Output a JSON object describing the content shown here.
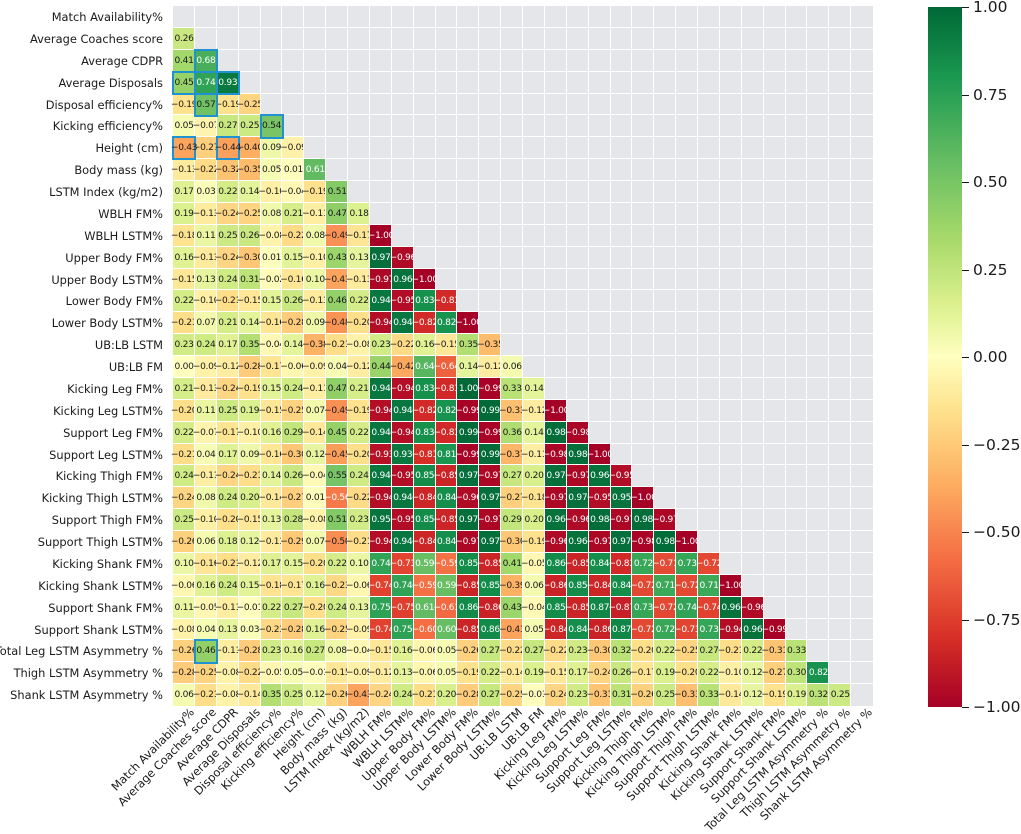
{
  "chart_data": {
    "type": "heatmap",
    "title": "",
    "xlabel": "",
    "ylabel": "",
    "mask": "lower-triangle (strictly below diagonal shown; diagonal and upper triangle blank)",
    "grid": true,
    "colorbar": {
      "colormap": "RdYlGn",
      "position": "right",
      "vmin": -1.0,
      "vmax": 1.0,
      "ticks": [
        "1.00",
        "0.75",
        "0.50",
        "0.25",
        "0.00",
        "-0.25",
        "-0.50",
        "-0.75",
        "-1.00"
      ],
      "tick_values": [
        1.0,
        0.75,
        0.5,
        0.25,
        0.0,
        -0.25,
        -0.5,
        -0.75,
        -1.0
      ]
    },
    "categories": [
      "Match Availability%",
      "Average Coaches score",
      "Average CDPR",
      "Average Disposals",
      "Disposal efficiency%",
      "Kicking efficiency%",
      "Height (cm)",
      "Body mass (kg)",
      "LSTM Index (kg/m2)",
      "WBLH FM%",
      "WBLH LSTM%",
      "Upper Body FM%",
      "Upper Body LSTM%",
      "Lower Body FM%",
      "Lower Body LSTM%",
      "UB:LB LSTM",
      "UB:LB FM",
      "Kicking Leg FM%",
      "Kicking Leg LSTM%",
      "Support Leg FM%",
      "Support Leg LSTM%",
      "Kicking Thigh FM%",
      "Kicking Thigh LSTM%",
      "Support Thigh FM%",
      "Support Thigh LSTM%",
      "Kicking Shank FM%",
      "Kicking Shank LSTM%",
      "Support Shank FM%",
      "Support Shank LSTM%",
      "Total Leg LSTM Asymmetry %",
      "Thigh LSTM Asymmetry %",
      "Shank LSTM Asymmetry %"
    ],
    "xtick_labels": [
      "Match Availability%",
      "Average Coaches score",
      "Average CDPR",
      "Average Disposals",
      "Disposal efficiency%",
      "Kicking efficiency%",
      "Height (cm)",
      "Body mass (kg)",
      "LSTM Index (kg/m2)",
      "WBLH FM%",
      "WBLH LSTM%",
      "Upper Body FM%",
      "Upper Body LSTM%",
      "Lower Body FM%",
      "Lower Body LSTM%",
      "UB:LB LSTM",
      "UB:LB FM",
      "Kicking Leg FM%",
      "Kicking Leg LSTM%",
      "Support Leg FM%",
      "Support Leg LSTM%",
      "Kicking Thigh FM%",
      "Kicking Thigh LSTM%",
      "Support Thigh FM%",
      "Support Thigh LSTM%",
      "Kicking Shank FM%",
      "Kicking Shank LSTM%",
      "Support Shank FM%",
      "Support Shank LSTM%",
      "Total Leg LSTM Asymmetry %",
      "Thigh LSTM Asymmetry %",
      "Shank LSTM Asymmetry %"
    ],
    "rows": [
      {
        "label": "Match Availability%",
        "values": []
      },
      {
        "label": "Average Coaches score",
        "values": [
          0.26
        ]
      },
      {
        "label": "Average CDPR",
        "values": [
          0.41,
          0.68
        ]
      },
      {
        "label": "Average Disposals",
        "values": [
          0.45,
          0.74,
          0.93
        ]
      },
      {
        "label": "Disposal efficiency%",
        "values": [
          -0.19,
          0.57,
          -0.19,
          -0.25
        ]
      },
      {
        "label": "Kicking efficiency%",
        "values": [
          0.05,
          -0.07,
          0.27,
          0.25,
          0.54
        ]
      },
      {
        "label": "Height (cm)",
        "values": [
          -0.43,
          -0.27,
          -0.44,
          -0.4,
          0.09,
          -0.09
        ]
      },
      {
        "label": "Body mass (kg)",
        "values": [
          -0.13,
          -0.22,
          -0.32,
          -0.35,
          0.05,
          0.01,
          0.61
        ]
      },
      {
        "label": "LSTM Index (kg/m2)",
        "values": [
          0.17,
          0.03,
          0.22,
          0.14,
          -0.1,
          -0.04,
          -0.19,
          0.51
        ]
      },
      {
        "label": "WBLH FM%",
        "values": [
          0.19,
          -0.13,
          -0.24,
          -0.25,
          0.08,
          0.21,
          -0.11,
          0.47,
          0.18
        ]
      },
      {
        "label": "WBLH LSTM%",
        "values": [
          -0.18,
          0.11,
          0.25,
          0.26,
          -0.08,
          -0.22,
          0.08,
          -0.49,
          -0.17,
          -1.0
        ]
      },
      {
        "label": "Upper Body FM%",
        "values": [
          0.16,
          -0.13,
          -0.24,
          -0.3,
          0.01,
          0.15,
          -0.1,
          0.43,
          0.13,
          0.97,
          -0.96
        ]
      },
      {
        "label": "Upper Body LSTM%",
        "values": [
          -0.15,
          0.13,
          0.24,
          0.31,
          -0.02,
          -0.16,
          0.1,
          -0.43,
          -0.13,
          -0.97,
          0.96,
          -1.0
        ]
      },
      {
        "label": "Lower Body FM%",
        "values": [
          0.22,
          -0.1,
          -0.21,
          -0.15,
          0.15,
          0.26,
          -0.13,
          0.46,
          0.22,
          0.94,
          -0.95,
          0.83,
          -0.83
        ]
      },
      {
        "label": "Lower Body LSTM%",
        "values": [
          -0.21,
          0.07,
          0.21,
          0.14,
          -0.16,
          -0.28,
          0.09,
          -0.48,
          -0.2,
          -0.94,
          0.94,
          -0.82,
          0.82,
          -1.0
        ]
      },
      {
        "label": "UB:LB LSTM",
        "values": [
          0.23,
          0.24,
          0.17,
          0.35,
          -0.04,
          0.14,
          -0.38,
          -0.21,
          -0.08,
          0.23,
          -0.22,
          0.16,
          -0.15,
          0.35,
          -0.35
        ]
      },
      {
        "label": "UB:LB FM",
        "values": [
          0.0,
          -0.09,
          -0.12,
          -0.28,
          -0.17,
          -0.06,
          -0.09,
          0.04,
          -0.12,
          0.44,
          -0.42,
          0.64,
          -0.64,
          0.14,
          -0.12,
          0.06
        ]
      },
      {
        "label": "Kicking Leg FM%",
        "values": [
          0.21,
          -0.13,
          -0.24,
          -0.19,
          0.15,
          0.24,
          -0.11,
          0.47,
          0.21,
          0.94,
          -0.94,
          0.83,
          -0.83,
          1.0,
          -0.99,
          0.33,
          0.14
        ]
      },
      {
        "label": "Kicking Leg LSTM%",
        "values": [
          -0.2,
          0.11,
          0.25,
          0.19,
          -0.15,
          -0.25,
          0.07,
          -0.49,
          -0.19,
          -0.94,
          0.94,
          -0.82,
          0.82,
          -0.99,
          0.99,
          -0.33,
          -0.12,
          -1.0
        ]
      },
      {
        "label": "Support Leg FM%",
        "values": [
          0.22,
          -0.07,
          -0.17,
          -0.1,
          0.16,
          0.29,
          -0.14,
          0.45,
          0.22,
          0.94,
          -0.94,
          0.83,
          -0.83,
          0.99,
          -0.99,
          0.36,
          0.14,
          0.98,
          -0.98
        ]
      },
      {
        "label": "Support Leg LSTM%",
        "values": [
          -0.21,
          0.04,
          0.17,
          0.09,
          -0.16,
          -0.3,
          0.12,
          -0.45,
          -0.2,
          -0.93,
          0.93,
          -0.81,
          0.81,
          -0.99,
          0.99,
          -0.37,
          -0.11,
          -0.98,
          0.98,
          -1.0
        ]
      },
      {
        "label": "Kicking Thigh FM%",
        "values": [
          0.24,
          -0.11,
          -0.24,
          -0.21,
          0.14,
          0.26,
          -0.04,
          0.55,
          0.24,
          0.94,
          -0.95,
          0.85,
          -0.85,
          0.97,
          -0.97,
          0.27,
          0.2,
          0.97,
          -0.97,
          0.96,
          -0.95
        ]
      },
      {
        "label": "Kicking Thigh LSTM%",
        "values": [
          -0.24,
          0.08,
          0.24,
          0.2,
          -0.14,
          -0.27,
          0.01,
          -0.56,
          -0.22,
          -0.94,
          0.94,
          -0.84,
          0.84,
          -0.96,
          0.97,
          -0.27,
          -0.18,
          -0.97,
          0.97,
          -0.95,
          0.95,
          -1.0
        ]
      },
      {
        "label": "Support Thigh FM%",
        "values": [
          0.25,
          -0.1,
          -0.2,
          -0.15,
          0.13,
          0.28,
          -0.08,
          0.51,
          0.23,
          0.95,
          -0.95,
          0.85,
          -0.85,
          0.97,
          -0.97,
          0.29,
          0.2,
          0.96,
          -0.96,
          0.98,
          -0.97,
          0.98,
          -0.97
        ]
      },
      {
        "label": "Support Thigh LSTM%",
        "values": [
          -0.26,
          0.06,
          0.18,
          0.12,
          -0.13,
          -0.29,
          0.07,
          -0.5,
          -0.21,
          -0.94,
          0.94,
          -0.84,
          0.84,
          -0.97,
          0.97,
          -0.3,
          -0.19,
          -0.96,
          0.96,
          -0.97,
          0.97,
          -0.98,
          0.98,
          -1.0
        ]
      },
      {
        "label": "Kicking Shank FM%",
        "values": [
          0.1,
          -0.16,
          -0.21,
          -0.12,
          0.17,
          0.15,
          -0.2,
          0.22,
          0.1,
          0.74,
          -0.73,
          0.59,
          -0.59,
          0.85,
          -0.85,
          0.41,
          -0.05,
          0.86,
          -0.85,
          0.84,
          -0.83,
          0.72,
          -0.71,
          0.73,
          -0.72
        ]
      },
      {
        "label": "Kicking Shank LSTM%",
        "values": [
          -0.06,
          0.16,
          0.24,
          0.15,
          -0.18,
          -0.17,
          0.16,
          -0.23,
          -0.06,
          -0.74,
          0.74,
          -0.59,
          0.59,
          -0.85,
          0.85,
          -0.39,
          0.06,
          -0.86,
          0.85,
          -0.84,
          0.84,
          -0.72,
          0.71,
          -0.72,
          0.71,
          -1.0
        ]
      },
      {
        "label": "Support Shank FM%",
        "values": [
          0.11,
          -0.05,
          -0.11,
          -0.01,
          0.22,
          0.27,
          -0.2,
          0.24,
          0.13,
          0.75,
          -0.75,
          0.61,
          -0.61,
          0.86,
          -0.86,
          0.43,
          -0.04,
          0.85,
          -0.85,
          0.87,
          -0.87,
          0.73,
          -0.72,
          0.74,
          -0.74,
          0.96,
          -0.96
        ]
      },
      {
        "label": "Support Shank LSTM%",
        "values": [
          -0.08,
          0.04,
          0.13,
          0.03,
          -0.23,
          -0.28,
          0.16,
          -0.25,
          -0.09,
          -0.74,
          0.75,
          -0.6,
          0.6,
          -0.85,
          0.86,
          -0.43,
          0.05,
          -0.84,
          0.84,
          -0.86,
          0.87,
          -0.72,
          0.72,
          -0.73,
          0.73,
          -0.94,
          0.96,
          -0.99
        ]
      },
      {
        "label": "Total Leg LSTM Asymmetry %",
        "values": [
          -0.26,
          0.46,
          -0.11,
          -0.28,
          0.23,
          0.16,
          0.27,
          0.08,
          -0.04,
          -0.15,
          0.16,
          -0.06,
          0.05,
          -0.26,
          0.27,
          -0.22,
          0.27,
          -0.22,
          0.23,
          -0.3,
          0.32,
          -0.2,
          0.22,
          -0.25,
          0.27,
          -0.21,
          0.22,
          -0.31,
          0.33
        ]
      },
      {
        "label": "Thigh LSTM Asymmetry %",
        "values": [
          -0.28,
          -0.25,
          -0.08,
          -0.22,
          -0.05,
          0.05,
          -0.01,
          -0.15,
          -0.09,
          -0.12,
          0.13,
          -0.06,
          0.05,
          -0.19,
          0.22,
          -0.14,
          0.19,
          -0.15,
          0.17,
          -0.24,
          0.26,
          -0.17,
          0.19,
          -0.2,
          0.22,
          -0.1,
          0.12,
          -0.27,
          0.3,
          0.82
        ]
      },
      {
        "label": "Shank LSTM Asymmetry %",
        "values": [
          0.06,
          -0.21,
          -0.08,
          -0.14,
          0.35,
          0.25,
          0.12,
          -0.26,
          -0.43,
          -0.24,
          0.24,
          -0.21,
          0.2,
          -0.28,
          0.27,
          -0.25,
          -0.01,
          -0.24,
          0.23,
          -0.31,
          0.31,
          -0.26,
          0.25,
          -0.33,
          0.33,
          -0.14,
          0.12,
          -0.19,
          0.19,
          0.32,
          0.25
        ]
      }
    ],
    "highlighted_cells": [
      {
        "row": 2,
        "col": 1,
        "value": 0.68
      },
      {
        "row": 3,
        "col": 0,
        "value": 0.45
      },
      {
        "row": 3,
        "col": 1,
        "value": 0.74
      },
      {
        "row": 3,
        "col": 2,
        "value": 0.93
      },
      {
        "row": 4,
        "col": 1,
        "value": 0.57
      },
      {
        "row": 5,
        "col": 4,
        "value": 0.54
      },
      {
        "row": 6,
        "col": 0,
        "value": -0.43
      },
      {
        "row": 6,
        "col": 2,
        "value": -0.44
      },
      {
        "row": 29,
        "col": 1,
        "value": 0.46
      }
    ],
    "highlight_color": "#1f93d2"
  }
}
